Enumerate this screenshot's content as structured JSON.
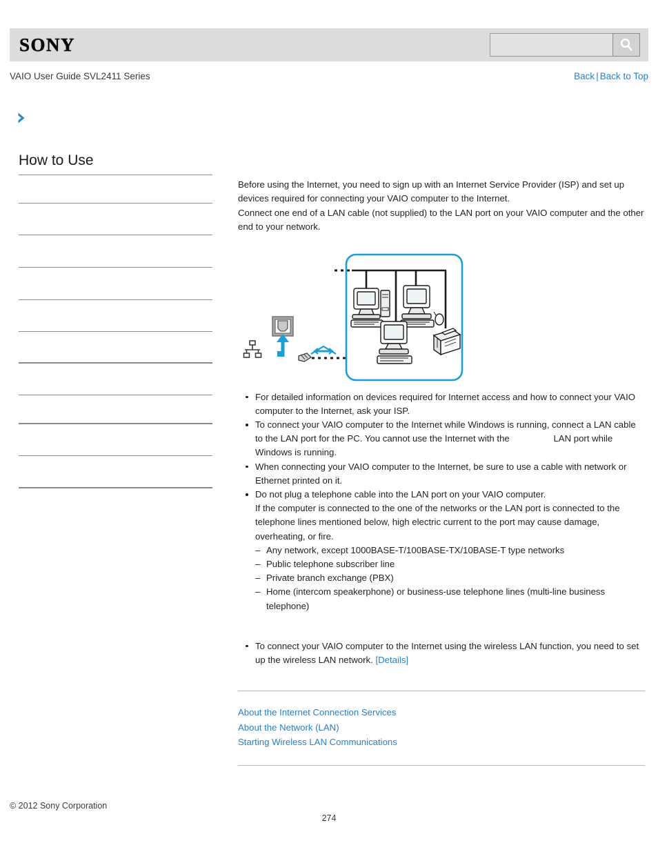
{
  "header": {
    "logo_text": "SONY",
    "search": {
      "value": "",
      "placeholder": "",
      "icon": "search-icon"
    },
    "guide_title": "VAIO User Guide SVL2411 Series",
    "nav": {
      "back_label": "Back",
      "separator": "|",
      "back_to_top_label": "Back to Top"
    },
    "colors": {
      "bar_background": "#dcdcdc",
      "link": "#2a7fc9"
    }
  },
  "breadcrumb": {
    "chevron_icon": "chevron-right-icon",
    "chevron_color": "#2a87c8",
    "text": ""
  },
  "sidebar": {
    "title": "How to Use",
    "items": [
      {
        "label": "",
        "rule": "thin"
      },
      {
        "label": "",
        "rule": "thin"
      },
      {
        "label": "",
        "rule": "thin"
      },
      {
        "label": "",
        "rule": "thin"
      },
      {
        "label": "",
        "rule": "thin"
      },
      {
        "label": "",
        "rule": "thin"
      },
      {
        "label": "",
        "rule": "thick"
      },
      {
        "label": "",
        "rule": "thin"
      },
      {
        "label": "",
        "rule": "thick"
      },
      {
        "label": "",
        "rule": "thin"
      },
      {
        "label": "",
        "rule": "thick"
      }
    ]
  },
  "main": {
    "intro_paragraphs": [
      "Before using the Internet, you need to sign up with an Internet Service Provider (ISP) and set up devices required for connecting your VAIO computer to the Internet.",
      "Connect one end of a LAN cable (not supplied) to the LAN port on your VAIO computer and the other end to your network."
    ],
    "figure": {
      "name": "lan-connection-diagram",
      "accent_color": "#1e9fe0",
      "elements": [
        "network-topology-icon",
        "lan-port-icon",
        "up-arrow",
        "lan-cable-connector",
        "cable-double-arrow",
        "dotted-cable",
        "network-box",
        "desktop-computer",
        "tower-pc",
        "desktop-computer-with-mouse",
        "desktop-computer-lower",
        "printer"
      ]
    },
    "notes": [
      {
        "text": "For detailed information on devices required for Internet access and how to connect your VAIO computer to the Internet, ask your ISP."
      },
      {
        "text_before": "To connect your VAIO computer to the Internet while Windows is running, connect a LAN cable to the LAN port for the PC. You cannot use the Internet with the",
        "text_after": "LAN port while Windows is running.",
        "has_inline_gap": true
      },
      {
        "text": "When connecting your VAIO computer to the Internet, be sure to use a cable with network or Ethernet printed on it."
      },
      {
        "text": "Do not plug a telephone cable into the LAN port on your VAIO computer.",
        "continuation": "If the computer is connected to the one of the networks or the LAN port is connected to the telephone lines mentioned below, high electric current to the port may cause damage, overheating, or fire.",
        "sub_items": [
          "Any network, except 1000BASE-T/100BASE-TX/10BASE-T type networks",
          "Public telephone subscriber line",
          "Private branch exchange (PBX)",
          "Home (intercom speakerphone) or business-use telephone lines (multi-line business telephone)"
        ]
      }
    ],
    "wireless_note": {
      "text": "To connect your VAIO computer to the Internet using the wireless LAN function, you need to set up the wireless LAN network.",
      "link_label": "[Details]"
    },
    "related_links": [
      "About the Internet Connection Services",
      "About the Network (LAN)",
      "Starting Wireless LAN Communications"
    ]
  },
  "footer": {
    "copyright": "© 2012 Sony Corporation",
    "page_number": "274"
  }
}
